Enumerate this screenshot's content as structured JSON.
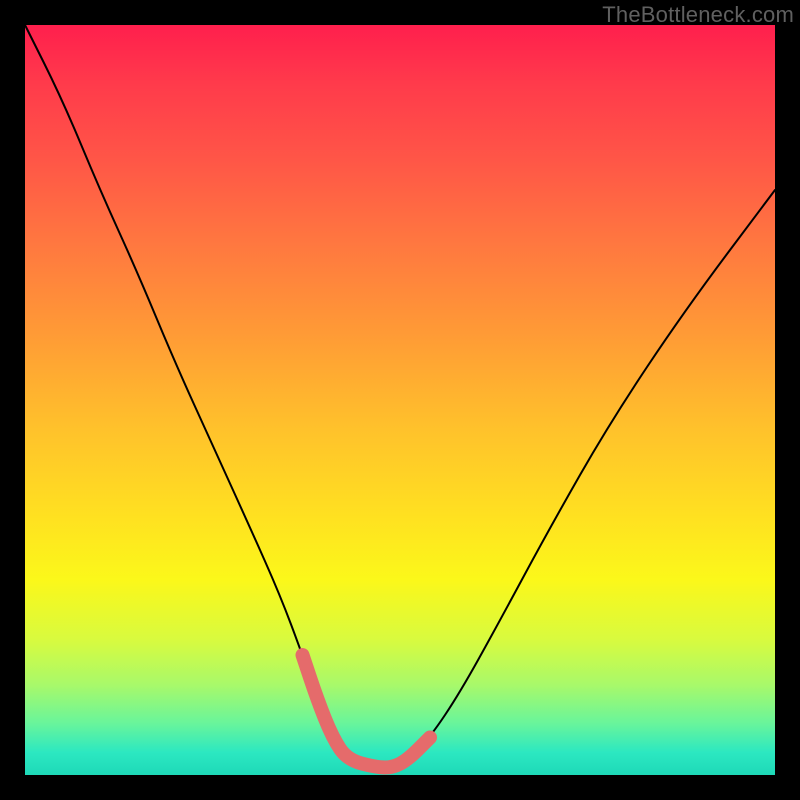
{
  "watermark": "TheBottleneck.com",
  "chart_data": {
    "type": "line",
    "title": "",
    "xlabel": "",
    "ylabel": "",
    "xlim": [
      0,
      100
    ],
    "ylim": [
      0,
      100
    ],
    "series": [
      {
        "name": "curve",
        "x": [
          0,
          5,
          10,
          15,
          20,
          25,
          30,
          34,
          37,
          39,
          41,
          43,
          47,
          49,
          51,
          54,
          58,
          63,
          70,
          78,
          88,
          100
        ],
        "values": [
          100,
          90,
          78,
          67,
          55,
          44,
          33,
          24,
          16,
          10,
          5,
          2,
          1,
          1,
          2,
          5,
          11,
          20,
          33,
          47,
          62,
          78
        ]
      },
      {
        "name": "highlight",
        "x": [
          37,
          39,
          41,
          43,
          47,
          49,
          51,
          54
        ],
        "values": [
          16,
          10,
          5,
          2,
          1,
          1,
          2,
          5
        ]
      }
    ],
    "colors": {
      "curve": "#000000",
      "highlight": "#e56b6b"
    }
  }
}
